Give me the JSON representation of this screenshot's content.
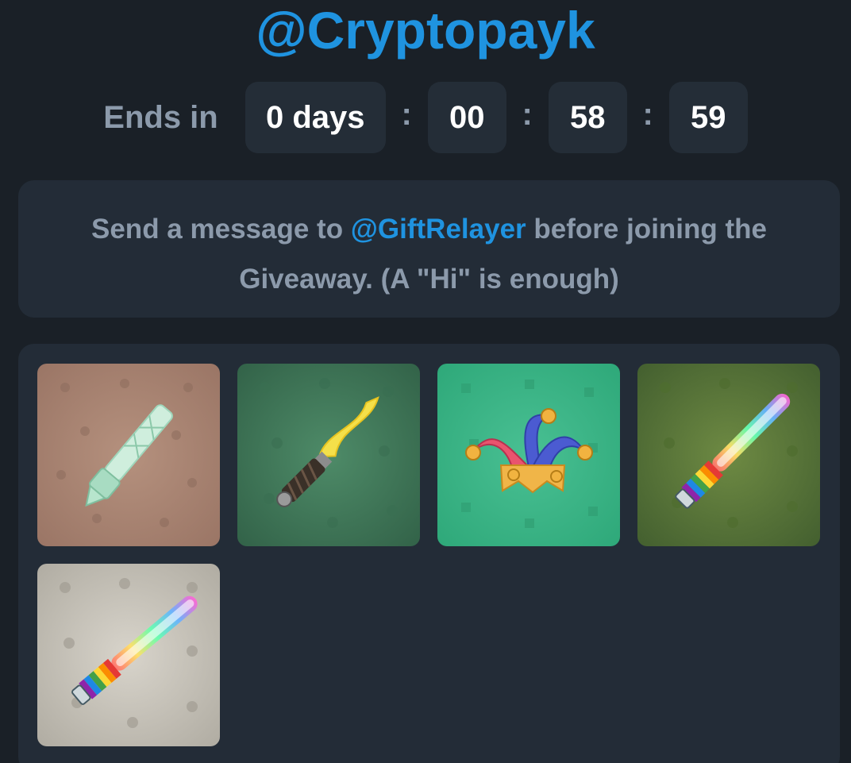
{
  "header": {
    "handle": "@Cryptopayk"
  },
  "countdown": {
    "label": "Ends in",
    "days": "0 days",
    "hours": "00",
    "minutes": "58",
    "seconds": "59",
    "separator": ":"
  },
  "notice": {
    "text_before": "Send a message to ",
    "link": "@GiftRelayer",
    "text_after": " before joining the Giveaway. (A \"Hi\" is enough)"
  },
  "gifts": [
    {
      "icon": "crystal-sword-icon"
    },
    {
      "icon": "lightning-sword-icon"
    },
    {
      "icon": "jester-hat-icon"
    },
    {
      "icon": "rainbow-lightsaber-icon"
    },
    {
      "icon": "rainbow-lightsaber-icon"
    }
  ],
  "colors": {
    "accent": "#1f93e0",
    "background": "#1a2027",
    "card": "#232c37",
    "muted_text": "#8c9aab"
  }
}
